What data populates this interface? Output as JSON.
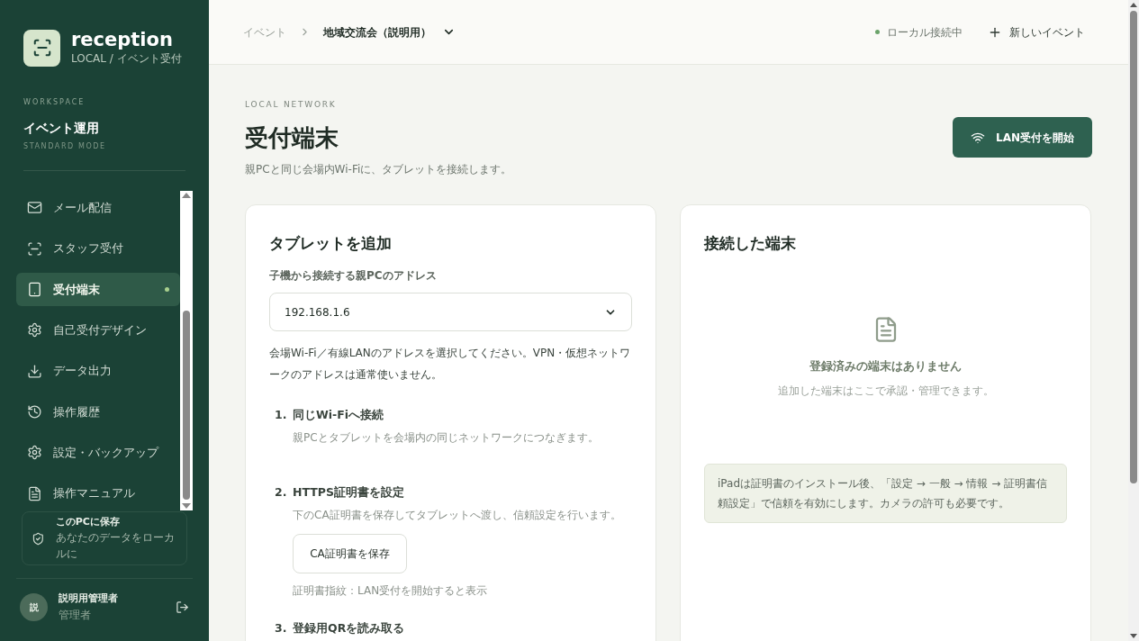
{
  "brand": {
    "name": "reception",
    "subtitle": "LOCAL / イベント受付"
  },
  "workspace": {
    "label": "WORKSPACE",
    "name": "イベント運用",
    "mode": "STANDARD MODE"
  },
  "sidebar": {
    "items": [
      {
        "kind": "mail",
        "label": "メール配信",
        "selected": false
      },
      {
        "kind": "scan",
        "label": "スタッフ受付",
        "selected": false
      },
      {
        "kind": "tablet",
        "label": "受付端末",
        "selected": true
      },
      {
        "kind": "gear",
        "label": "自己受付デザイン",
        "selected": false
      },
      {
        "kind": "download",
        "label": "データ出力",
        "selected": false
      },
      {
        "kind": "history",
        "label": "操作履歴",
        "selected": false
      },
      {
        "kind": "gear",
        "label": "設定・バックアップ",
        "selected": false
      },
      {
        "kind": "doc",
        "label": "操作マニュアル",
        "selected": false
      }
    ]
  },
  "storage": {
    "title": "このPCに保存",
    "subtitle": "あなたのデータをローカルに"
  },
  "user": {
    "avatar": "説",
    "name": "説明用管理者",
    "role": "管理者"
  },
  "header": {
    "breadcrumb_root": "イベント",
    "event": "地域交流会（説明用）",
    "status": "ローカル接続中",
    "new_event": "新しいイベント"
  },
  "page": {
    "eyebrow": "LOCAL NETWORK",
    "title": "受付端末",
    "description": "親PCと同じ会場内Wi-Fiに、タブレットを接続します。",
    "action": "LAN受付を開始"
  },
  "add_card": {
    "title": "タブレットを追加",
    "field_label": "子機から接続する親PCのアドレス",
    "address": "192.168.1.6",
    "note": "会場Wi-Fi／有線LANのアドレスを選択してください。VPN・仮想ネットワークのアドレスは通常使いません。",
    "steps": [
      {
        "number": "1.",
        "title": "同じWi-Fiへ接続",
        "text": "親PCとタブレットを会場内の同じネットワークにつなぎます。"
      },
      {
        "number": "2.",
        "title": "HTTPS証明書を設定",
        "text": "下のCA証明書を保存してタブレットへ渡し、信頼設定を行います。",
        "button": "CA証明書を保存",
        "footnote": "証明書指紋：LAN受付を開始すると表示"
      },
      {
        "number": "3.",
        "title": "登録用QRを読み取る"
      }
    ]
  },
  "devices_card": {
    "title": "接続した端末",
    "empty_title": "登録済みの端末はありません",
    "empty_text": "追加した端末はここで承認・管理できます。",
    "notice": "iPadは証明書のインストール後、「設定 → 一般 → 情報 → 証明書信頼設定」で信頼を有効にします。カメラの許可も必要です。"
  }
}
